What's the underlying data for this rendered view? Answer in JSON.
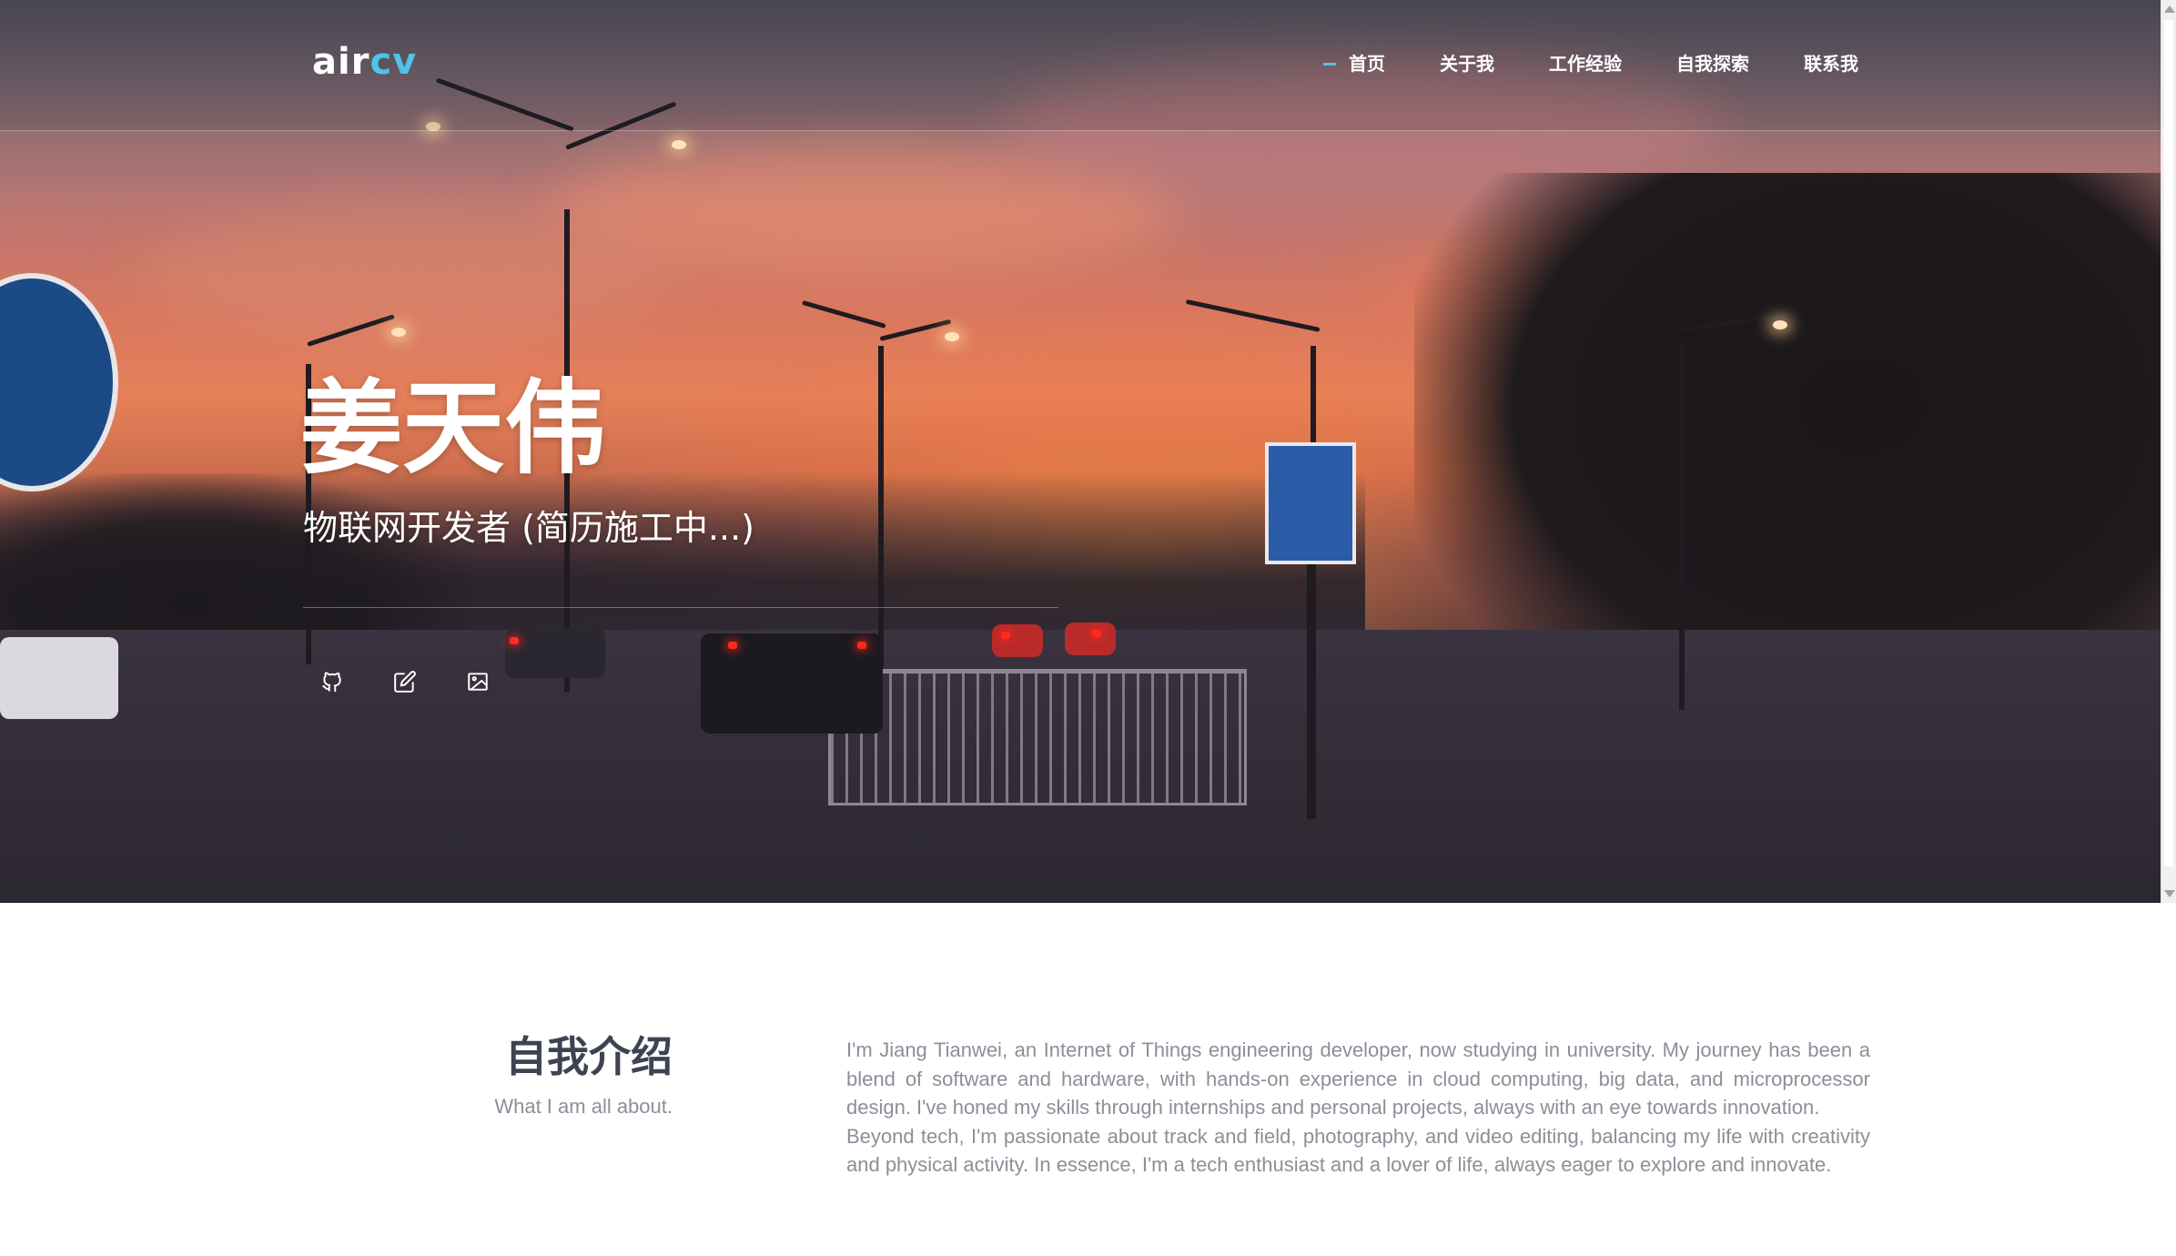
{
  "header": {
    "logo_part1": "air",
    "logo_part2": "cv",
    "nav": [
      {
        "label": "首页",
        "active": true
      },
      {
        "label": "关于我",
        "active": false
      },
      {
        "label": "工作经验",
        "active": false
      },
      {
        "label": "自我探索",
        "active": false
      },
      {
        "label": "联系我",
        "active": false
      }
    ]
  },
  "hero": {
    "title": "姜天伟",
    "subtitle": "物联网开发者 (简历施工中...)",
    "social_icons": [
      "github-icon",
      "edit-icon",
      "image-icon"
    ]
  },
  "about": {
    "heading": "自我介绍",
    "subheading": "What I am all about.",
    "paragraphs": [
      "I'm Jiang Tianwei, an Internet of Things engineering developer, now studying in university. My journey has been a blend of software and hardware, with hands-on experience in cloud computing, big data, and microprocessor design. I've honed my skills through internships and personal projects, always with an eye towards innovation.",
      "Beyond tech, I'm passionate about track and field, photography, and video editing, balancing my life with creativity and physical activity. In essence, I'm a tech enthusiast and a lover of life, always eager to explore and innovate."
    ]
  },
  "colors": {
    "accent": "#4fc3e8",
    "heading": "#3d4352",
    "body_text": "#8a8f99"
  }
}
